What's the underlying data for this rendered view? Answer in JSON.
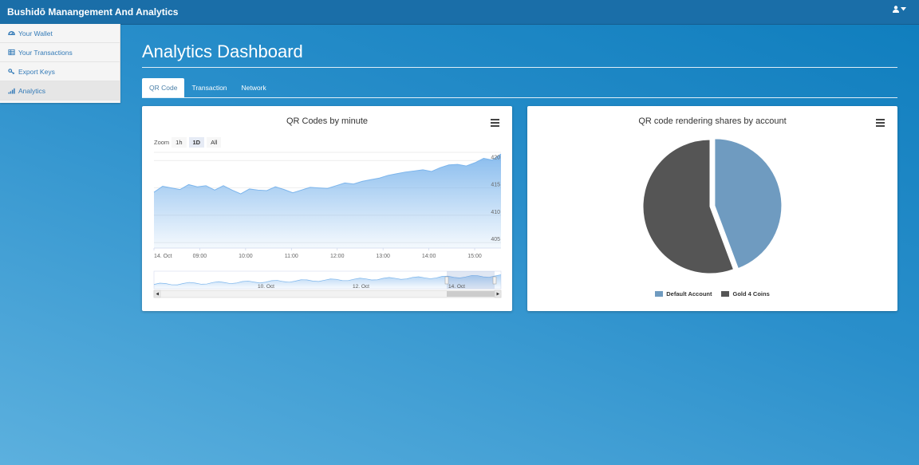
{
  "navbar": {
    "brand": "Bushidō Manangement And Analytics",
    "user_icon": "user-icon"
  },
  "sidebar": {
    "items": [
      {
        "label": "Your Wallet",
        "icon": "dashboard-icon"
      },
      {
        "label": "Your Transactions",
        "icon": "table-icon"
      },
      {
        "label": "Export Keys",
        "icon": "key-icon"
      },
      {
        "label": "Analytics",
        "icon": "signal-icon"
      }
    ]
  },
  "main": {
    "title": "Analytics Dashboard",
    "tabs": [
      {
        "label": "QR Code"
      },
      {
        "label": "Transaction"
      },
      {
        "label": "Network"
      }
    ]
  },
  "line_chart": {
    "title": "QR Codes by minute",
    "zoom_label": "Zoom",
    "zoom_buttons": [
      "1h",
      "1D",
      "All"
    ],
    "navigator_labels": [
      "10. Oct",
      "12. Oct",
      "14. Oct"
    ]
  },
  "pie_chart": {
    "title": "QR code rendering shares by account"
  },
  "chart_data": [
    {
      "type": "area",
      "title": "QR Codes by minute",
      "x": [
        "14. Oct",
        "09:00",
        "10:00",
        "11:00",
        "12:00",
        "13:00",
        "14:00",
        "15:00"
      ],
      "y_ticks": [
        405,
        410,
        415,
        420
      ],
      "ylim": [
        404,
        421.5
      ],
      "series": [
        {
          "values": [
            414.2,
            415.3,
            415.0,
            414.7,
            415.6,
            415.2,
            415.4,
            414.6,
            415.4,
            414.6,
            413.9,
            414.8,
            414.6,
            414.5,
            415.2,
            414.7,
            414.1,
            414.6,
            415.1,
            415.0,
            414.9,
            415.4,
            415.9,
            415.7,
            416.2,
            416.5,
            416.8,
            417.3,
            417.6,
            417.9,
            418.1,
            418.3,
            418.0,
            418.7,
            419.2,
            419.3,
            419.0,
            419.6,
            420.4,
            420.1,
            421.2
          ]
        }
      ],
      "color": "#7cb5ec"
    },
    {
      "type": "pie",
      "title": "QR code rendering shares by account",
      "legend_placement": "bottom",
      "slices": [
        {
          "name": "Default Account",
          "value": 44.3,
          "color": "#6f9bc0"
        },
        {
          "name": "Gold 4 Coins",
          "value": 55.7,
          "color": "#555555"
        }
      ]
    }
  ]
}
